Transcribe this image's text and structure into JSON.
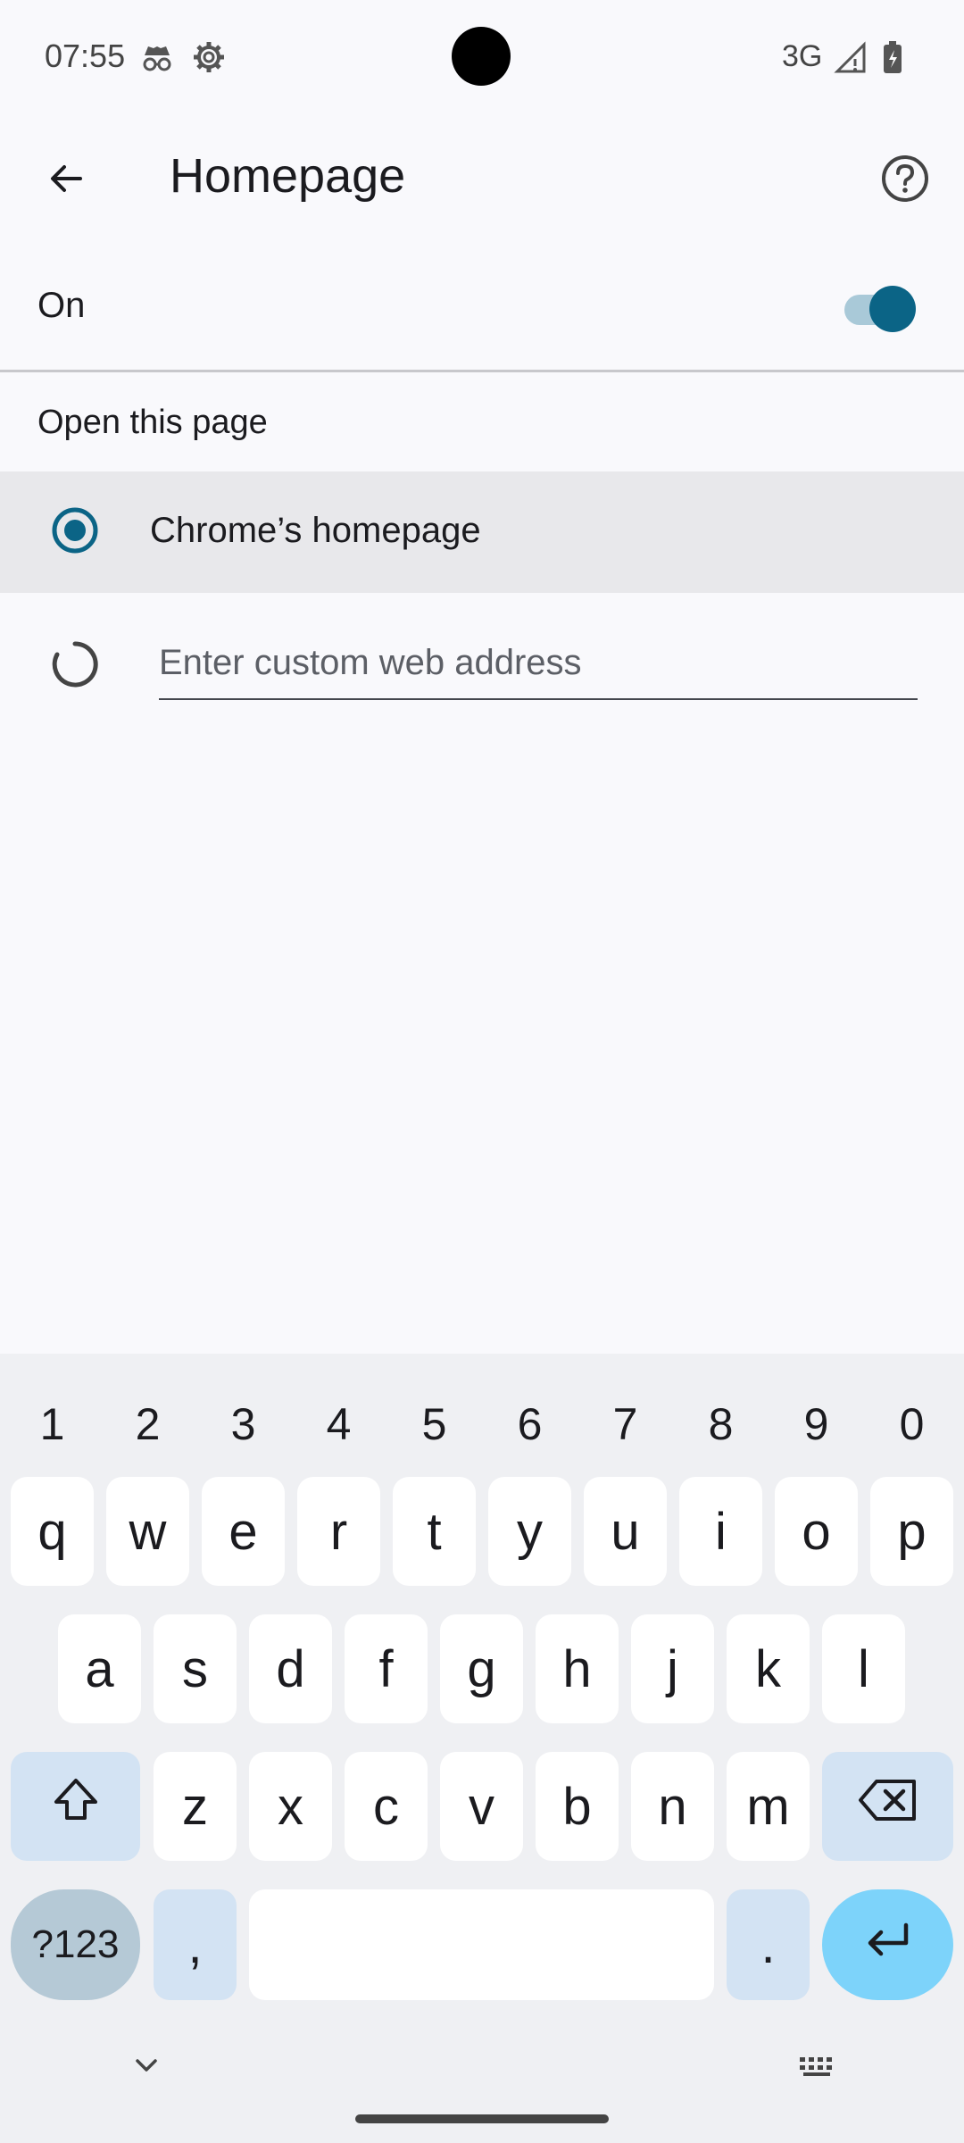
{
  "status_bar": {
    "time": "07:55",
    "network": "3G",
    "icons": [
      "incognito-icon",
      "settings-gear-icon",
      "signal-icon",
      "battery-charging-icon"
    ]
  },
  "app_bar": {
    "title": "Homepage",
    "back_icon": "arrow-left-icon",
    "help_icon": "help-circle-icon"
  },
  "toggle_row": {
    "label": "On",
    "checked": true
  },
  "section": {
    "title": "Open this page"
  },
  "options": {
    "chrome_homepage": {
      "label": "Chrome’s homepage",
      "selected": true
    },
    "custom": {
      "placeholder": "Enter custom web address",
      "value": "",
      "selected": false
    }
  },
  "keyboard": {
    "numbers": [
      "1",
      "2",
      "3",
      "4",
      "5",
      "6",
      "7",
      "8",
      "9",
      "0"
    ],
    "row1": [
      "q",
      "w",
      "e",
      "r",
      "t",
      "y",
      "u",
      "i",
      "o",
      "p"
    ],
    "row2": [
      "a",
      "s",
      "d",
      "f",
      "g",
      "h",
      "j",
      "k",
      "l"
    ],
    "row3": [
      "z",
      "x",
      "c",
      "v",
      "b",
      "n",
      "m"
    ],
    "symbols_key": "?123",
    "comma_key": ",",
    "period_key": ".",
    "shift_icon": "shift-icon",
    "backspace_icon": "backspace-icon",
    "enter_icon": "enter-icon",
    "hide_icon": "chevron-down-icon",
    "switch_icon": "keyboard-switch-icon"
  },
  "colors": {
    "accent": "#0b6486",
    "toggle_track": "#a9c9d8",
    "selected_row": "#e8e8eb",
    "enter_key": "#7dd3fa",
    "mod_key": "#d3e3f3"
  }
}
